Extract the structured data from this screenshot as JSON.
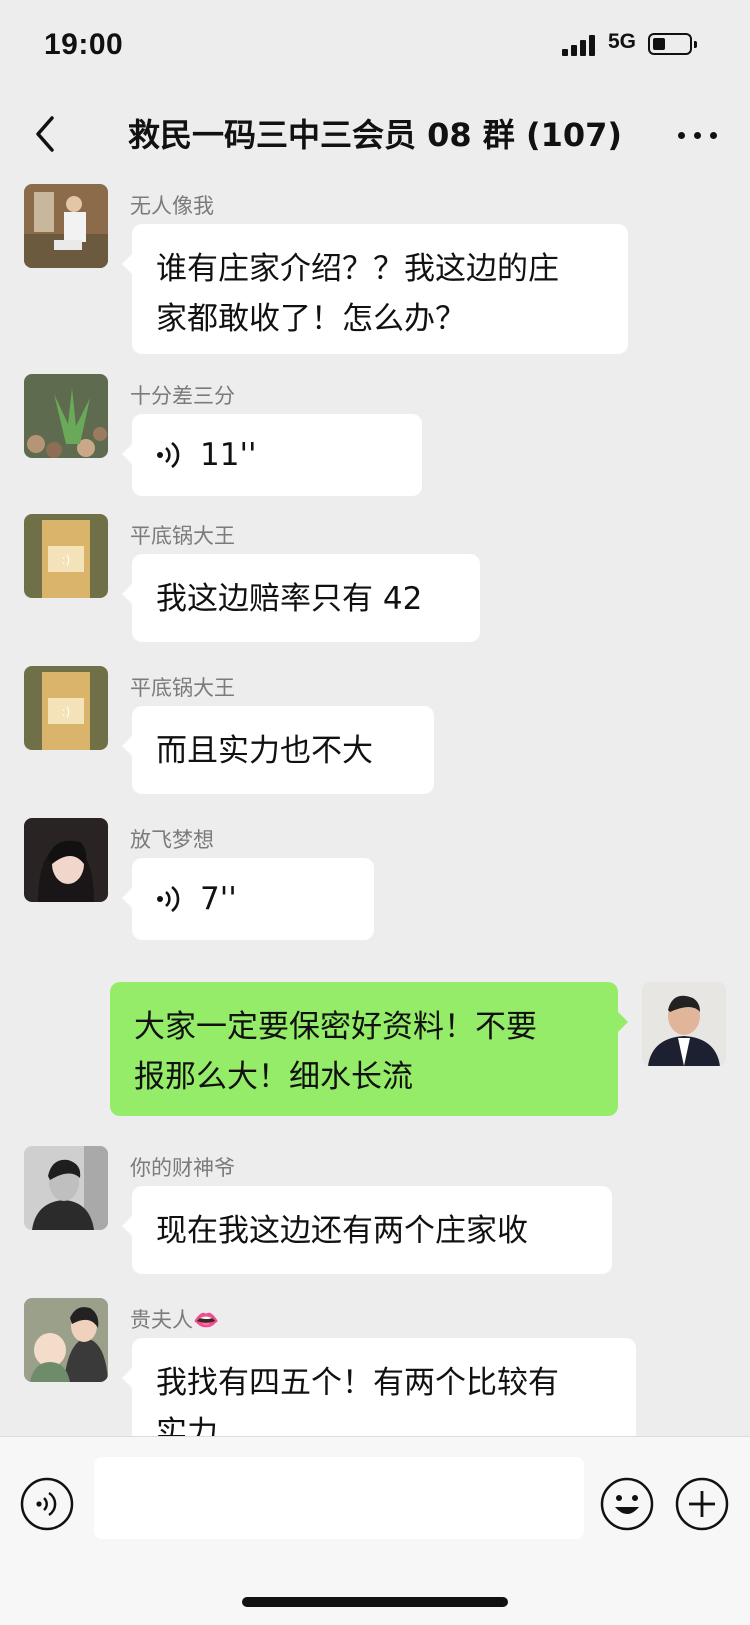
{
  "status_bar": {
    "time": "19:00",
    "network": "5G"
  },
  "header": {
    "title": "救民一码三中三会员 08 群 (107)"
  },
  "messages": [
    {
      "sender": "无人像我",
      "text": "谁有庄家介绍？？我这边的庄家都敢收了！怎么办？",
      "line1": "谁有庄家介绍？？我这边的庄",
      "line2": "家都敢收了！怎么办？"
    },
    {
      "sender": "十分差三分",
      "voice_duration": "11''"
    },
    {
      "sender": "平底锅大王",
      "text": "我这边赔率只有 42"
    },
    {
      "sender": "平底锅大王",
      "text": "而且实力也不大"
    },
    {
      "sender": "放飞梦想",
      "voice_duration": "7''"
    },
    {
      "sender": "me",
      "line1": "大家一定要保密好资料！不要",
      "line2": "报那么大！细水长流"
    },
    {
      "sender": "你的财神爷",
      "text": "现在我这边还有两个庄家收"
    },
    {
      "sender": "贵夫人👄",
      "line1": "我找有四五个！有两个比较有",
      "line2": "实力"
    }
  ],
  "input": {
    "placeholder": ""
  },
  "icons": {
    "back": "chevron-left-icon",
    "more": "more-dots-icon",
    "voice_toggle": "voice-icon",
    "emoji": "emoji-icon",
    "plus": "plus-icon"
  },
  "colors": {
    "background": "#ededed",
    "my_bubble": "#95ec69",
    "other_bubble": "#ffffff"
  }
}
